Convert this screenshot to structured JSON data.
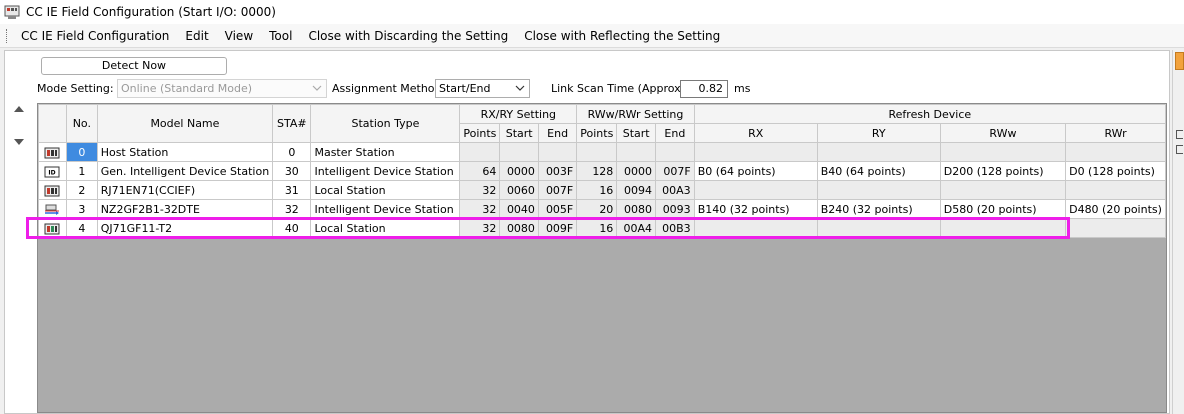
{
  "window": {
    "title": "CC IE Field Configuration (Start I/O: 0000)"
  },
  "menu": [
    "CC IE Field Configuration",
    "Edit",
    "View",
    "Tool",
    "Close with Discarding the Setting",
    "Close with Reflecting the Setting"
  ],
  "toolbar": {
    "detect_label": "Detect Now",
    "mode_label": "Mode Setting:",
    "mode_value": "Online (Standard Mode)",
    "assign_label": "Assignment Method:",
    "assign_value": "Start/End",
    "scan_label": "Link Scan Time (Approx.):",
    "scan_value": "0.82",
    "scan_unit": "ms"
  },
  "colors": {
    "highlight": "#ee1ee9",
    "selected_no": "#3f8be0"
  },
  "grid": {
    "headers": {
      "no": "No.",
      "model": "Model Name",
      "sta": "STA#",
      "station_type": "Station Type",
      "rxry": "RX/RY Setting",
      "rwwrwr": "RWw/RWr Setting",
      "refresh": "Refresh Device",
      "points": "Points",
      "start": "Start",
      "end": "End",
      "rx": "RX",
      "ry": "RY",
      "rww": "RWw",
      "rwr": "RWr"
    },
    "rows": [
      {
        "icon": "master-station-icon",
        "no": "0",
        "model": "Host Station",
        "sta": "0",
        "type": "Master Station",
        "rx_points": "",
        "rx_start": "",
        "rx_end": "",
        "rw_points": "",
        "rw_start": "",
        "rw_end": "",
        "ref_rx": "",
        "ref_ry": "",
        "ref_rww": "",
        "ref_rwr": ""
      },
      {
        "icon": "intelligent-device-icon",
        "no": "1",
        "model": "Gen. Intelligent Device Station",
        "sta": "30",
        "type": "Intelligent Device Station",
        "rx_points": "64",
        "rx_start": "0000",
        "rx_end": "003F",
        "rw_points": "128",
        "rw_start": "0000",
        "rw_end": "007F",
        "ref_rx": "B0 (64 points)",
        "ref_ry": "B40 (64 points)",
        "ref_rww": "D200 (128 points)",
        "ref_rwr": "D0 (128 points)"
      },
      {
        "icon": "local-station-icon",
        "no": "2",
        "model": "RJ71EN71(CCIEF)",
        "sta": "31",
        "type": "Local Station",
        "rx_points": "32",
        "rx_start": "0060",
        "rx_end": "007F",
        "rw_points": "16",
        "rw_start": "0094",
        "rw_end": "00A3",
        "ref_rx": "",
        "ref_ry": "",
        "ref_rww": "",
        "ref_rwr": ""
      },
      {
        "icon": "network-device-icon",
        "no": "3",
        "model": "NZ2GF2B1-32DTE",
        "sta": "32",
        "type": "Intelligent Device Station",
        "rx_points": "32",
        "rx_start": "0040",
        "rx_end": "005F",
        "rw_points": "20",
        "rw_start": "0080",
        "rw_end": "0093",
        "ref_rx": "B140 (32 points)",
        "ref_ry": "B240 (32 points)",
        "ref_rww": "D580 (20 points)",
        "ref_rwr": "D480 (20 points)"
      },
      {
        "icon": "local-station-icon",
        "no": "4",
        "model": "QJ71GF11-T2",
        "sta": "40",
        "type": "Local Station",
        "rx_points": "32",
        "rx_start": "0080",
        "rx_end": "009F",
        "rw_points": "16",
        "rw_start": "00A4",
        "rw_end": "00B3",
        "ref_rx": "",
        "ref_ry": "",
        "ref_rww": "",
        "ref_rwr": ""
      }
    ]
  }
}
